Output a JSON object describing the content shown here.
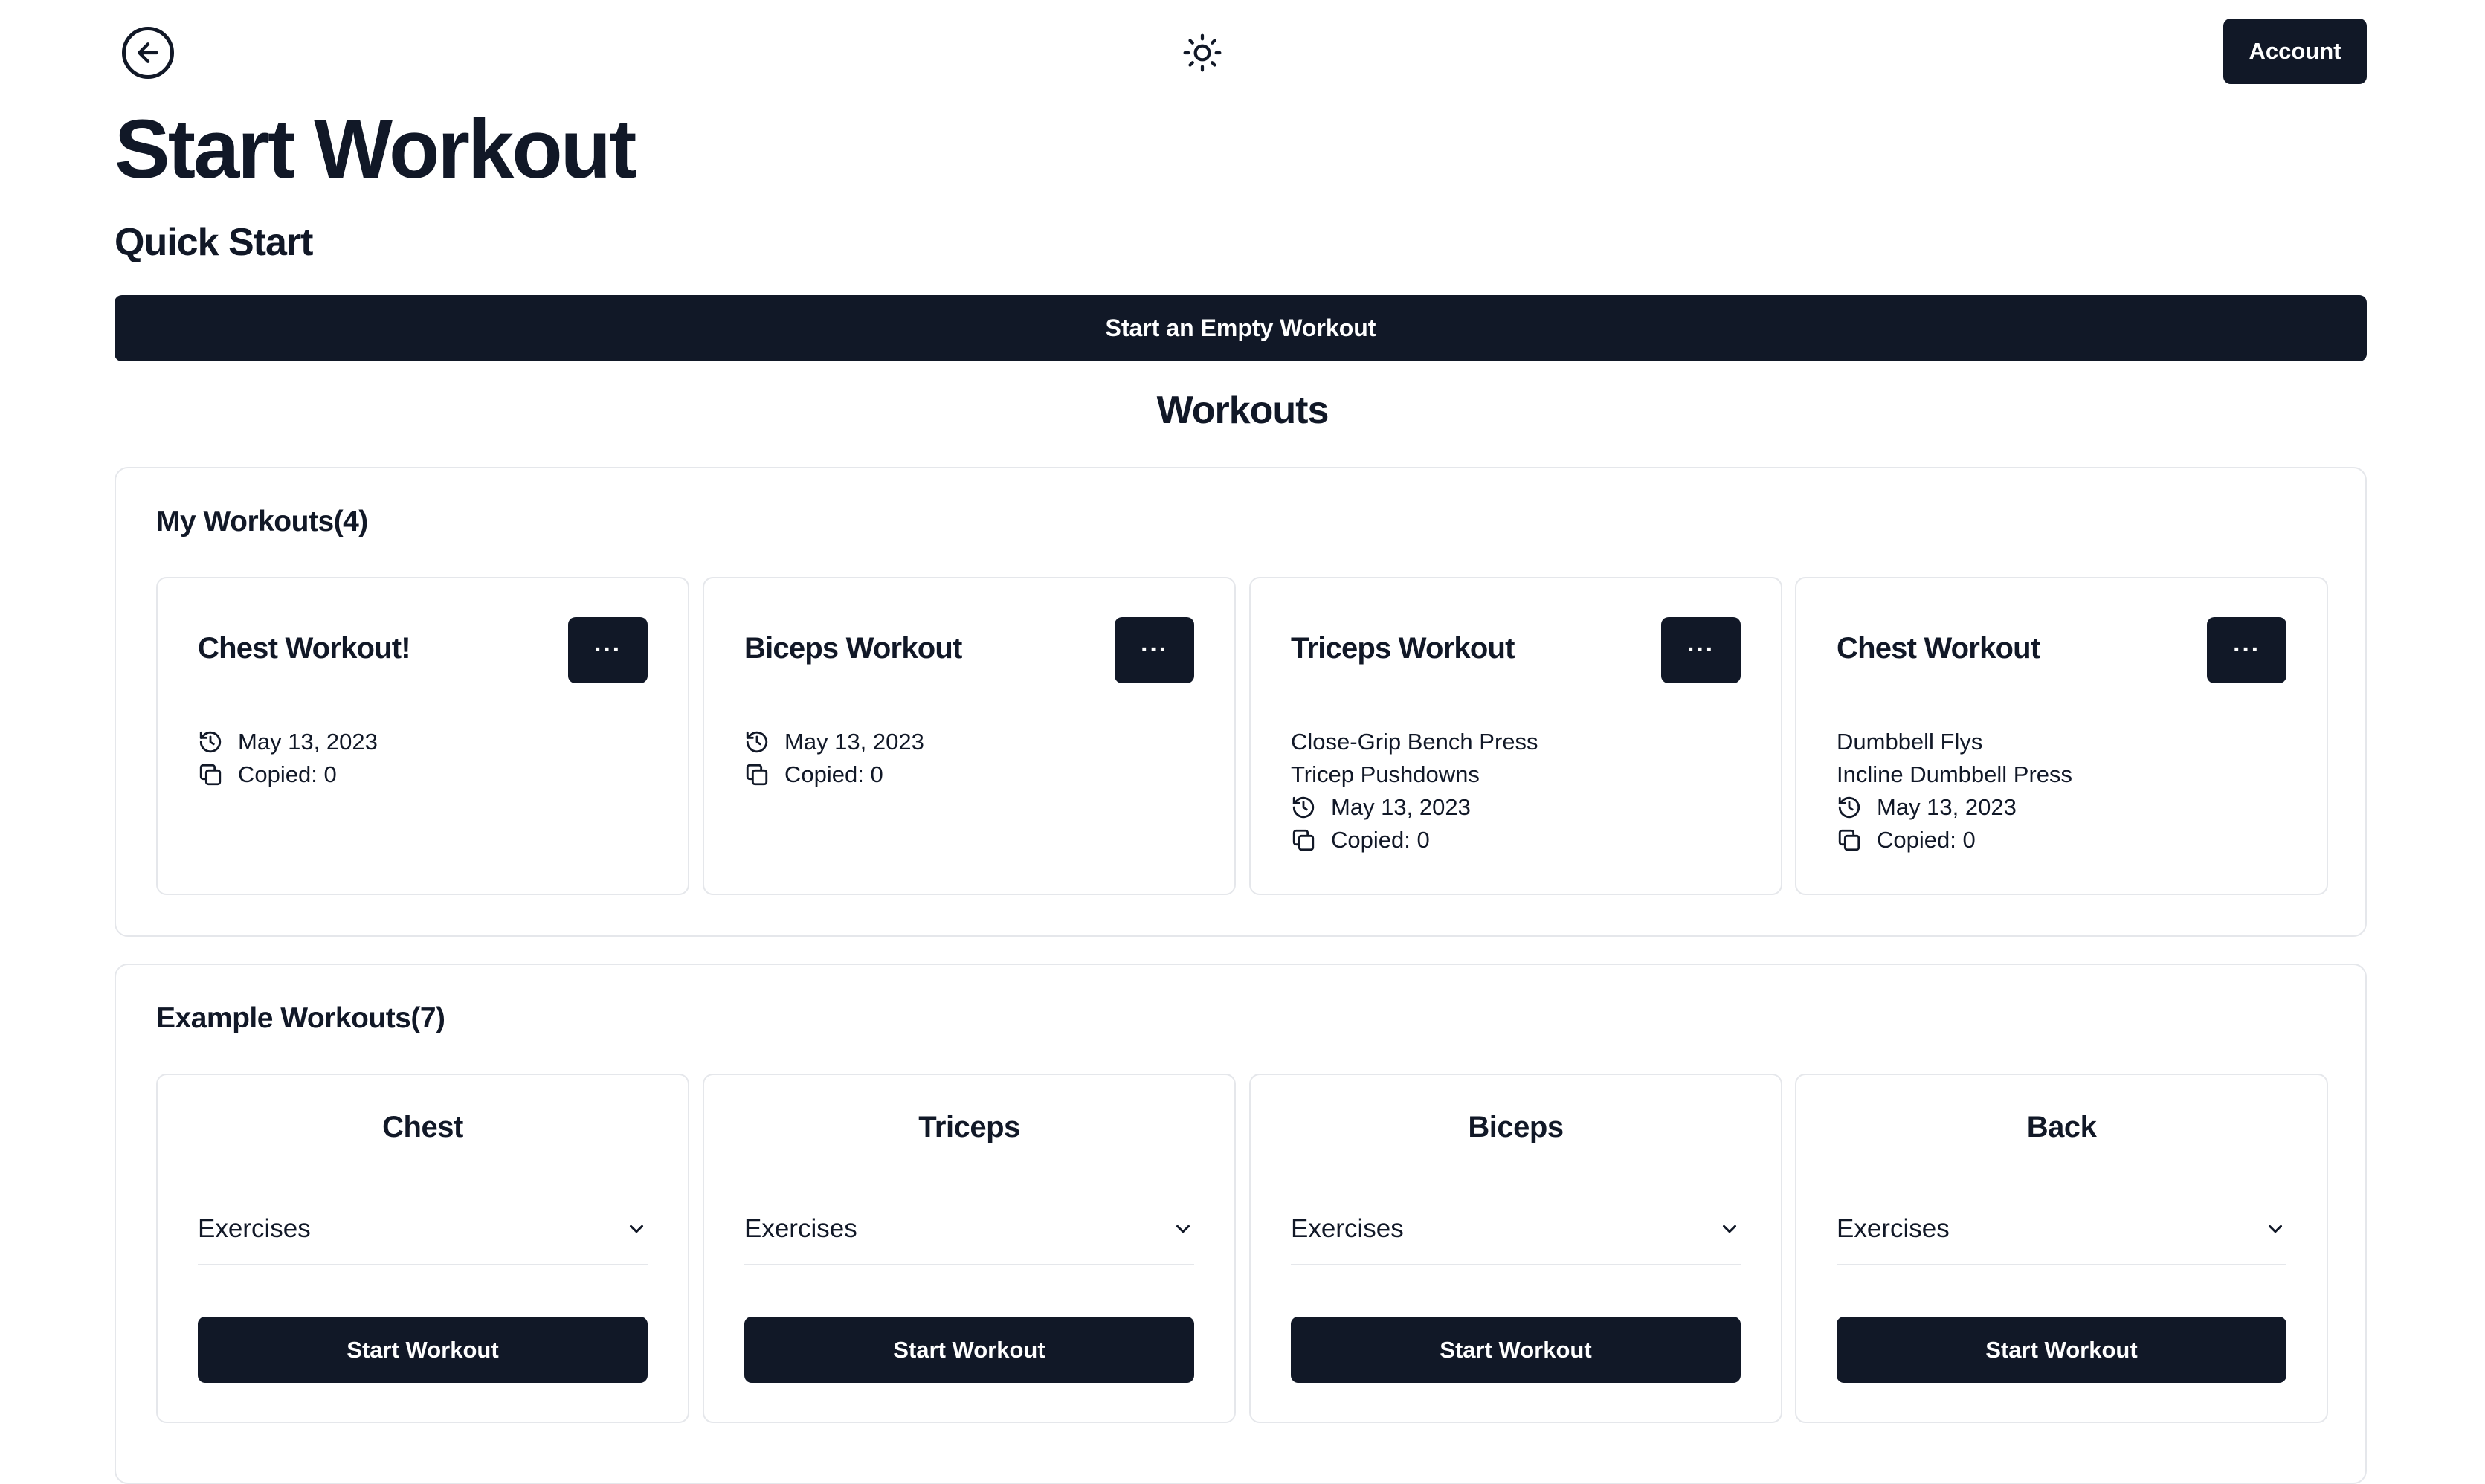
{
  "header": {
    "back_icon": "arrow-left-circle-icon",
    "theme_icon": "sun-icon",
    "account_label": "Account"
  },
  "page_title": "Start Workout",
  "quick_start": {
    "heading": "Quick Start",
    "empty_workout_label": "Start an Empty Workout"
  },
  "workouts_heading": "Workouts",
  "my_workouts": {
    "title": "My Workouts(4)",
    "menu_label": "···",
    "items": [
      {
        "title": "Chest Workout!",
        "exercises": [],
        "date": "May 13, 2023",
        "copied": "Copied: 0"
      },
      {
        "title": "Biceps Workout",
        "exercises": [],
        "date": "May 13, 2023",
        "copied": "Copied: 0"
      },
      {
        "title": "Triceps Workout",
        "exercises": [
          "Close-Grip Bench Press",
          "Tricep Pushdowns"
        ],
        "date": "May 13, 2023",
        "copied": "Copied: 0"
      },
      {
        "title": "Chest Workout",
        "exercises": [
          "Dumbbell Flys",
          "Incline Dumbbell Press"
        ],
        "date": "May 13, 2023",
        "copied": "Copied: 0"
      }
    ]
  },
  "example_workouts": {
    "title": "Example Workouts(7)",
    "items": [
      {
        "title": "Chest",
        "dropdown_label": "Exercises",
        "start_label": "Start Workout"
      },
      {
        "title": "Triceps",
        "dropdown_label": "Exercises",
        "start_label": "Start Workout"
      },
      {
        "title": "Biceps",
        "dropdown_label": "Exercises",
        "start_label": "Start Workout"
      },
      {
        "title": "Back",
        "dropdown_label": "Exercises",
        "start_label": "Start Workout"
      }
    ]
  },
  "colors": {
    "primary": "#111827",
    "border": "#e5e7eb",
    "background": "#ffffff"
  }
}
